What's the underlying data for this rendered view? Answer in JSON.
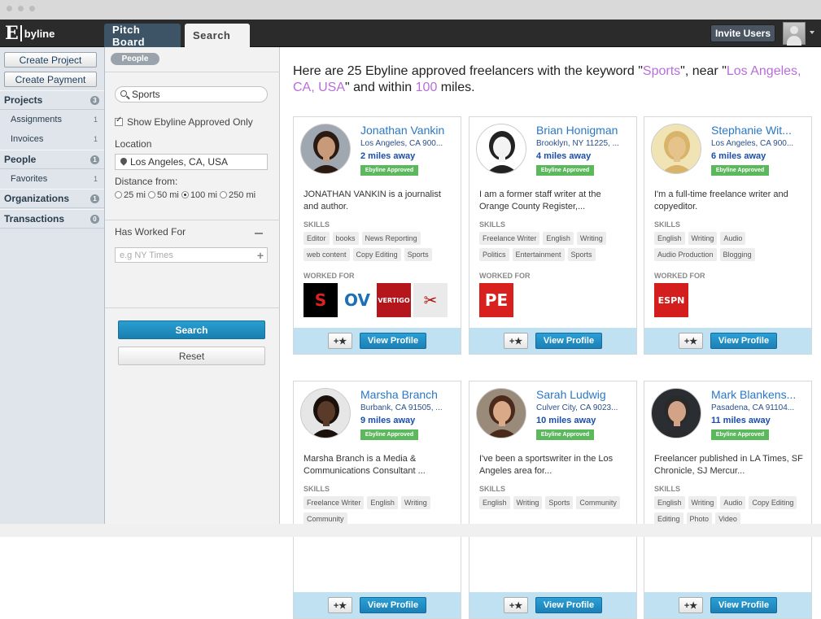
{
  "topbar": {
    "logo_e": "E",
    "logo_by": "byline",
    "tabs": [
      {
        "label": "Pitch Board"
      },
      {
        "label": "Search"
      }
    ],
    "invite_label": "Invite Users"
  },
  "sidebar": {
    "create_project": "Create Project",
    "create_payment": "Create Payment",
    "items": [
      {
        "label": "Projects",
        "badge": "3"
      },
      {
        "label": "Assignments",
        "count": "1"
      },
      {
        "label": "Invoices",
        "count": "1"
      },
      {
        "label": "People",
        "badge": "1"
      },
      {
        "label": "Favorites",
        "count": "1"
      },
      {
        "label": "Organizations",
        "badge": "1"
      },
      {
        "label": "Transactions",
        "badge": "0"
      }
    ]
  },
  "filters": {
    "tag": "People",
    "keyword": "Sports",
    "approved_only_label": "Show Ebyline Approved Only",
    "approved_only": true,
    "location_label": "Location",
    "location_value": "Los Angeles, CA, USA",
    "distance_label": "Distance from:",
    "distances": [
      "25 mi",
      "50 mi",
      "100 mi",
      "250 mi"
    ],
    "distance_selected": "100 mi",
    "worked_for_label": "Has Worked For",
    "worked_for_placeholder": "e.g NY Times",
    "search_label": "Search",
    "reset_label": "Reset"
  },
  "results": {
    "headline_pre": "Here are 25 Ebyline approved freelancers with the keyword \"",
    "keyword": "Sports",
    "headline_mid": "\", near \"",
    "location": "Los Angeles, CA, USA",
    "headline_mid2": "\" and within ",
    "miles": "100",
    "headline_post": " miles.",
    "approved_badge": "Ebyline Approved",
    "skills_label": "SKILLS",
    "worked_for_label": "WORKED FOR",
    "star_label": "+★",
    "view_label": "View Profile",
    "cards": [
      {
        "name": "Jonathan Vankin",
        "location": "Los Angeles, CA 900...",
        "distance": "2 miles away",
        "bio": "JONATHAN VANKIN is a journalist and author.",
        "skills": [
          "Editor",
          "books",
          "News Reporting",
          "web content",
          "Copy Editing",
          "Sports"
        ],
        "logos": [
          {
            "text": "S",
            "bg": "#000000",
            "fg": "#e02020"
          },
          {
            "text": "OV",
            "bg": "#ffffff",
            "fg": "#1d6fb8"
          },
          {
            "text": "VERTIGO",
            "bg": "#b4161b",
            "fg": "#ffffff"
          },
          {
            "text": "✂",
            "bg": "#eaeaea",
            "fg": "#b01010"
          }
        ],
        "photo": {
          "skin": "#c79a7a",
          "hair": "#2a1a12",
          "bg": "#9fa8b0"
        }
      },
      {
        "name": "Brian Honigman",
        "location": "Brooklyn, NY 11225, ...",
        "distance": "4 miles away",
        "bio": "I am a former staff writer at the Orange County Register,...",
        "skills": [
          "Freelance Writer",
          "English",
          "Writing",
          "Politics",
          "Entertainment",
          "Sports"
        ],
        "logos": [
          {
            "text": "PE",
            "bg": "#d8201f",
            "fg": "#ffffff"
          }
        ],
        "photo": {
          "skin": "#f3f3f3",
          "hair": "#222222",
          "bg": "#ffffff"
        }
      },
      {
        "name": "Stephanie Wit...",
        "location": "Los Angeles, CA 900...",
        "distance": "6 miles away",
        "bio": "I'm a full-time freelance writer and copyeditor.",
        "skills": [
          "English",
          "Writing",
          "Audio",
          "Audio Production",
          "Blogging"
        ],
        "logos": [
          {
            "text": "ESPN",
            "bg": "#d41e1e",
            "fg": "#ffffff"
          }
        ],
        "photo": {
          "skin": "#e6c38a",
          "hair": "#d7b46a",
          "bg": "#f1e4b4"
        }
      },
      {
        "name": "Marsha Branch",
        "location": "Burbank, CA 91505, ...",
        "distance": "9 miles away",
        "bio": "Marsha Branch is a Media & Communications Consultant ...",
        "skills": [
          "Freelance Writer",
          "English",
          "Writing",
          "Community"
        ],
        "logos": [],
        "photo": {
          "skin": "#5a3a28",
          "hair": "#1a110c",
          "bg": "#e6e6e6"
        }
      },
      {
        "name": "Sarah Ludwig",
        "location": "Culver City, CA 9023...",
        "distance": "10 miles away",
        "bio": "I've been a sportswriter in the Los Angeles area for...",
        "skills": [
          "English",
          "Writing",
          "Sports",
          "Community"
        ],
        "logos": [],
        "photo": {
          "skin": "#d9a988",
          "hair": "#4a2a1a",
          "bg": "#9a8a7a"
        }
      },
      {
        "name": "Mark Blankens...",
        "location": "Pasadena, CA 91104...",
        "distance": "11 miles away",
        "bio": "Freelancer published in LA Times, SF Chronicle, SJ Mercur...",
        "skills": [
          "English",
          "Writing",
          "Audio",
          "Copy Editing",
          "Editing",
          "Photo",
          "Video"
        ],
        "logos": [],
        "photo": {
          "skin": "#d2a386",
          "hair": "#2a2a2a",
          "bg": "#2a2e33"
        }
      }
    ]
  }
}
